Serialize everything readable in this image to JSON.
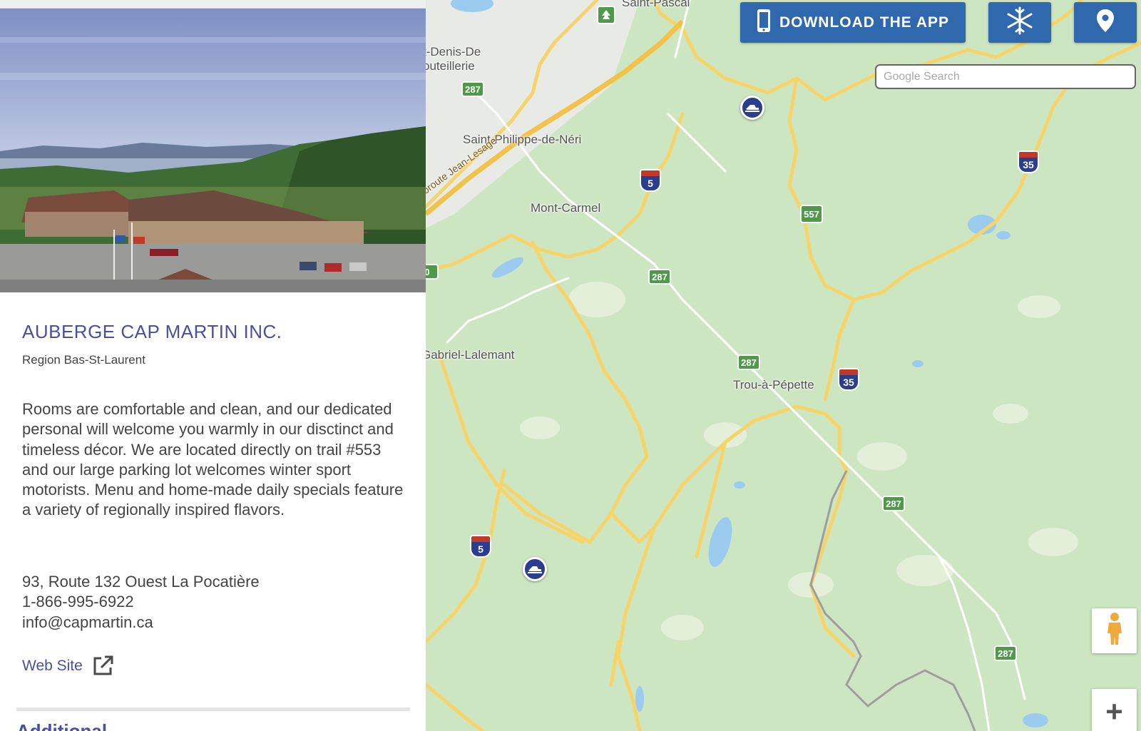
{
  "business": {
    "title": "AUBERGE CAP MARTIN INC.",
    "region": "Region Bas-St-Laurent",
    "description": "Rooms are comfortable and clean, and our dedicated personal will welcome you warmly in our disctinct and timeless décor. We are located directly on trail #553 and our large parking lot welcomes winter sport motorists. Menu and home-made daily specials feature a variety of regionally inspired flavors.",
    "address": "93, Route 132 Ouest La Pocatière",
    "phone": "1-866-995-6922",
    "email": "info@capmartin.ca",
    "website_label": "Web Site",
    "next_section_heading": "Additional"
  },
  "toolbar": {
    "download_label": "DOWNLOAD THE APP",
    "snow_icon": "snowflake-icon",
    "location_icon": "map-pin-icon"
  },
  "search": {
    "placeholder": "Google Search"
  },
  "map": {
    "places": {
      "saint_pascal": "Saint-Pascal",
      "saint_denis": "t-Denis-De",
      "saint_denis_2": "outeillerie",
      "saint_philippe": "Saint-Philippe-de-Néri",
      "autoroute": "oroute Jean-Lesage",
      "mont_carmel": "Mont-Carmel",
      "saint_gabriel": "Gabriel-Lalemant",
      "trou_a_pepette": "Trou-à-Pépette"
    },
    "routes": {
      "r287": "287",
      "r557": "557",
      "i5": "5",
      "i35": "35",
      "edge_label": "0"
    },
    "colors": {
      "land": "#cde6c2",
      "road_major": "#f7d46a",
      "road_minor": "#ffffff",
      "water": "#9ccbf0",
      "accent_blue": "#2f68ad",
      "title_purple": "#4a4fa0"
    }
  },
  "controls": {
    "zoom_in_label": "+",
    "pegman_icon": "pegman-icon"
  }
}
